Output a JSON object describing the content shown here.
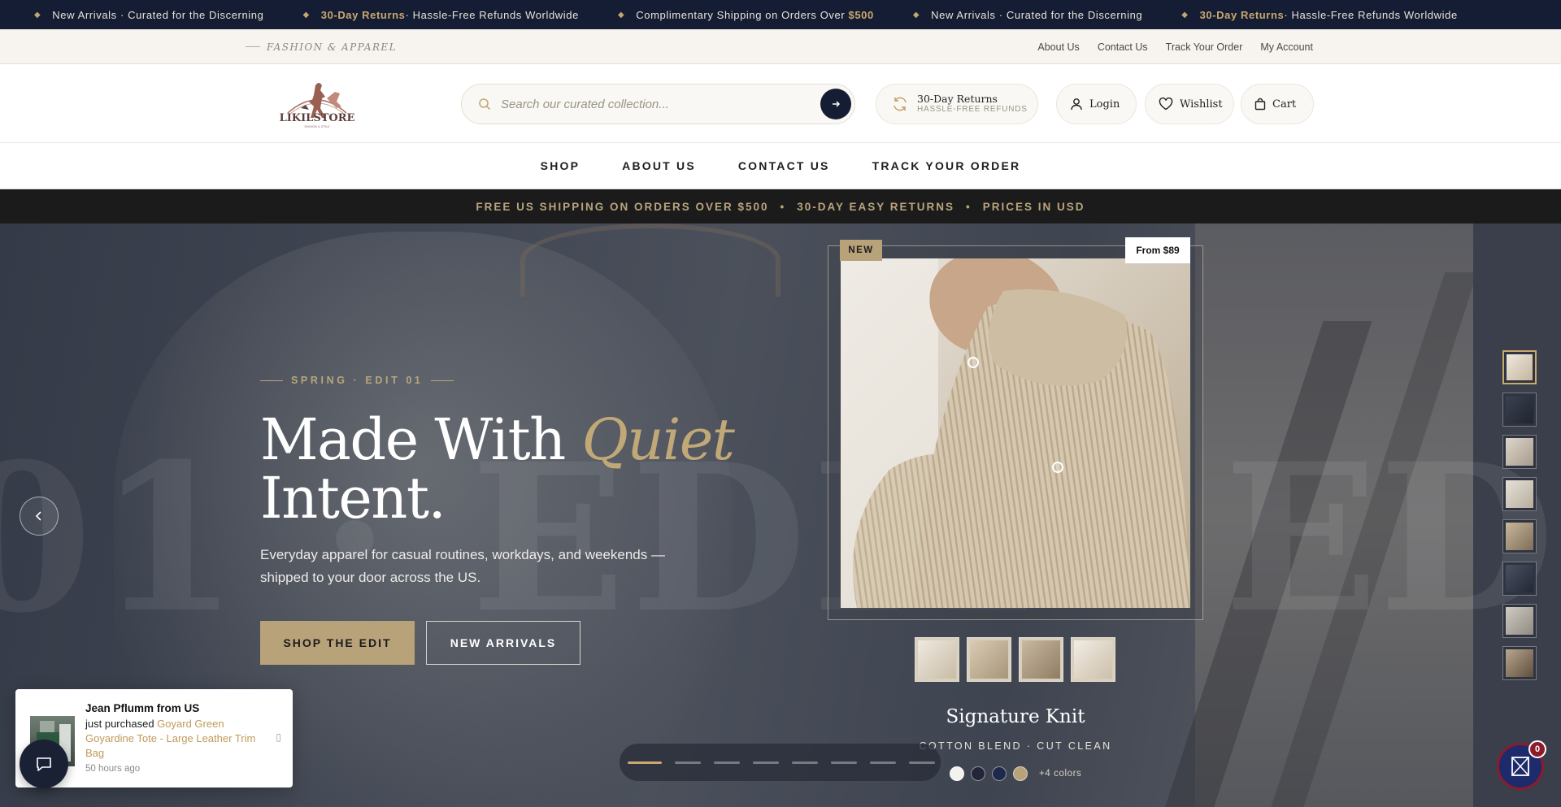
{
  "marquee": {
    "items": [
      {
        "hl": "",
        "text": "New Arrivals · Curated for the Discerning"
      },
      {
        "hl": "30-Day Returns",
        "text": " · Hassle-Free Refunds Worldwide"
      },
      {
        "hl": "",
        "text": "Complimentary Shipping on Orders Over ",
        "tail": "$500"
      },
      {
        "hl": "",
        "text": "New Arrivals · Curated for the Discerning"
      },
      {
        "hl": "30-Day Returns",
        "text": " · Hassle-Free Refunds Worldwide"
      }
    ]
  },
  "util": {
    "tagline": "FASHION & APPAREL",
    "links": [
      "About Us",
      "Contact Us",
      "Track Your Order",
      "My Account"
    ]
  },
  "header": {
    "logo_text": "LIKILSTORE",
    "logo_sub": "FASHION & STYLE",
    "search_placeholder": "Search our curated collection...",
    "returns_title": "30-Day Returns",
    "returns_sub": "HASSLE-FREE REFUNDS",
    "login": "Login",
    "wishlist": "Wishlist",
    "cart": "Cart"
  },
  "nav": [
    "SHOP",
    "ABOUT US",
    "CONTACT US",
    "TRACK YOUR ORDER"
  ],
  "promo": [
    "FREE US SHIPPING ON ORDERS OVER $500",
    "30-DAY EASY RETURNS",
    "PRICES IN USD"
  ],
  "hero": {
    "bg_word_left": "01 · EDIT",
    "bg_word_right": "ED",
    "eyebrow": "SPRING · EDIT 01",
    "headline_1": "Made With ",
    "headline_quiet": "Quiet",
    "headline_2": "Intent.",
    "subcopy": "Everyday apparel for casual routines, workdays, and weekends — shipped to your door across the US.",
    "cta_primary": "SHOP THE EDIT",
    "cta_secondary": "NEW ARRIVALS",
    "badge_new": "NEW",
    "badge_price": "From $89",
    "product_title": "Signature Knit",
    "product_sub": "COTTON BLEND · CUT CLEAN",
    "swatches": [
      "#f4f2ee",
      "#23263a",
      "#1f2a4a",
      "#b8a27a"
    ],
    "more_colors": "+4 colors",
    "slide_count": 8,
    "active_slide": 1,
    "side_thumb_count": 8
  },
  "toast": {
    "who": "Jean Pflumm from US",
    "prefix": "just purchased ",
    "product": "Goyard Green Goyardine Tote - Large Leather Trim Bag",
    "ago": "50 hours ago"
  },
  "cart_count": "0",
  "colors": {
    "navy": "#141d33",
    "gold": "#c9a96e",
    "sand": "#b8a27a"
  }
}
